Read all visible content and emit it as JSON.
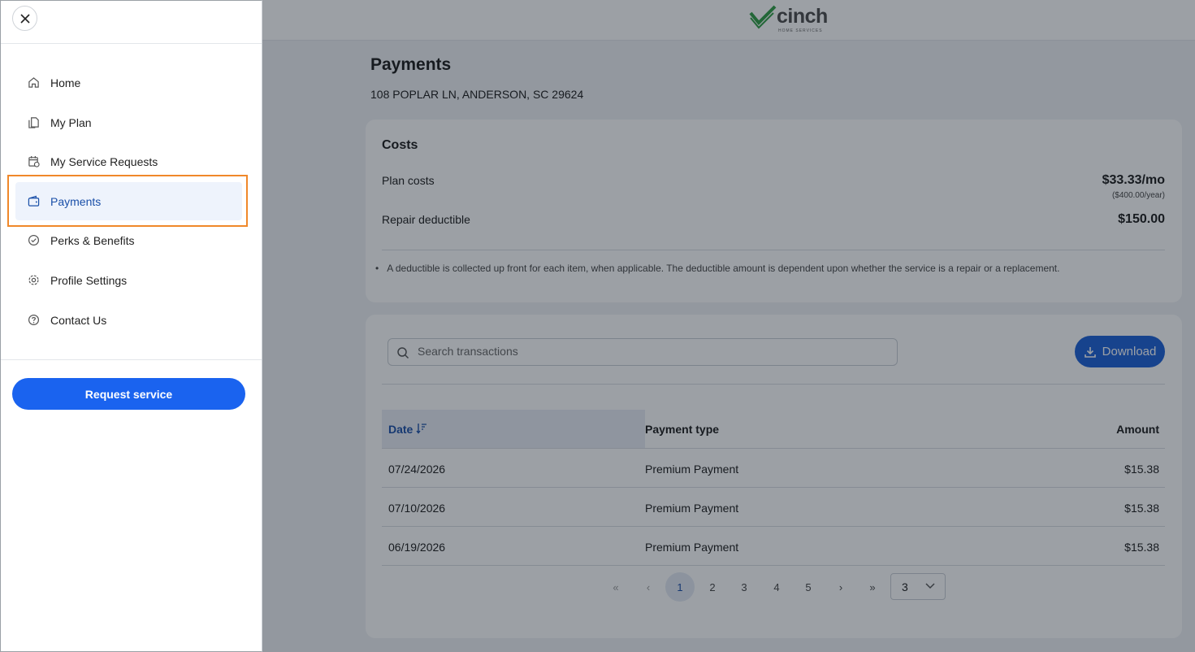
{
  "brand": {
    "name": "cinch",
    "tagline": "HOME SERVICES",
    "check_color": "#2f9e44"
  },
  "page": {
    "title": "Payments",
    "address": "108 POPLAR LN, ANDERSON, SC 29624"
  },
  "costs": {
    "title": "Costs",
    "plan_label": "Plan costs",
    "plan_value": "$33.33/mo",
    "plan_sub": "($400.00/year)",
    "deductible_label": "Repair deductible",
    "deductible_value": "$150.00",
    "note": "A deductible is collected up front for each item, when applicable. The deductible amount is dependent upon whether the service is a repair or a replacement."
  },
  "transactions": {
    "search_placeholder": "Search transactions",
    "download_label": "Download",
    "columns": {
      "date": "Date",
      "type": "Payment type",
      "amount": "Amount"
    },
    "rows": [
      {
        "date": "07/24/2026",
        "type": "Premium Payment",
        "amount": "$15.38"
      },
      {
        "date": "07/10/2026",
        "type": "Premium Payment",
        "amount": "$15.38"
      },
      {
        "date": "06/19/2026",
        "type": "Premium Payment",
        "amount": "$15.38"
      }
    ],
    "pages": [
      "1",
      "2",
      "3",
      "4",
      "5"
    ],
    "current_page": "1",
    "page_size": "3"
  },
  "sidebar": {
    "items": [
      {
        "label": "Home",
        "icon": "home-icon"
      },
      {
        "label": "My Plan",
        "icon": "document-icon"
      },
      {
        "label": "My Service Requests",
        "icon": "calendar-icon"
      },
      {
        "label": "Payments",
        "icon": "wallet-icon",
        "active": true
      },
      {
        "label": "Perks & Benefits",
        "icon": "check-badge-icon"
      },
      {
        "label": "Profile Settings",
        "icon": "gear-icon"
      },
      {
        "label": "Contact Us",
        "icon": "help-icon"
      }
    ],
    "request_label": "Request service"
  },
  "colors": {
    "accent": "#1a63ef",
    "active_text": "#1a4fa8",
    "highlight": "#f0882a"
  }
}
